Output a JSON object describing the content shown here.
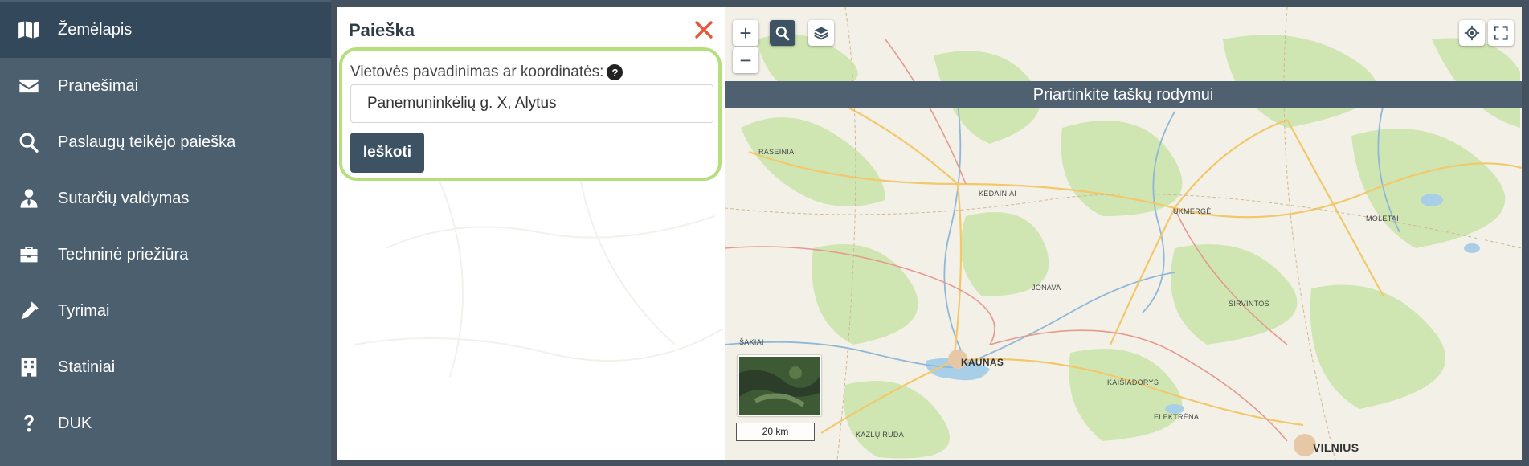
{
  "sidebar": {
    "items": [
      {
        "label": "Žemėlapis",
        "icon": "map-icon"
      },
      {
        "label": "Pranešimai",
        "icon": "envelope-icon"
      },
      {
        "label": "Paslaugų teikėjo paieška",
        "icon": "search-icon"
      },
      {
        "label": "Sutarčių valdymas",
        "icon": "user-tie-icon"
      },
      {
        "label": "Techninė priežiūra",
        "icon": "briefcase-icon"
      },
      {
        "label": "Tyrimai",
        "icon": "pipette-icon"
      },
      {
        "label": "Statiniai",
        "icon": "building-icon"
      },
      {
        "label": "DUK",
        "icon": "question-icon"
      }
    ],
    "active_index": 0
  },
  "search_panel": {
    "title": "Paieška",
    "field_label": "Vietovės pavadinimas ar koordinatės:",
    "help_glyph": "?",
    "input_value": "Panemuninkėlių g. X, Alytus",
    "search_button": "Ieškoti"
  },
  "map": {
    "zoom_in": "+",
    "zoom_out": "−",
    "banner": "Priartinkite taškų rodymui",
    "scale_label": "20 km",
    "cities": {
      "raseiniai": "RASEINIAI",
      "kedainiai": "KĖDAINIAI",
      "ukmerge": "UKMERGĖ",
      "moletai": "MOLĖTAI",
      "jonava": "JONAVA",
      "sirvintos": "ŠIRVINTOS",
      "sakiai": "ŠAKIAI",
      "kaunas": "KAUNAS",
      "kaisiadorys": "KAIŠIADORYS",
      "elektrenai": "ELEKTRĖNAI",
      "kazlu_ruda": "KAZLŲ RŪDA",
      "vilnius": "VILNIUS"
    }
  },
  "colors": {
    "sidebar_bg": "#4c5f6f",
    "sidebar_active": "#33495b",
    "accent": "#3d5364",
    "highlight_border": "#b5de7d",
    "close": "#e8553a"
  }
}
